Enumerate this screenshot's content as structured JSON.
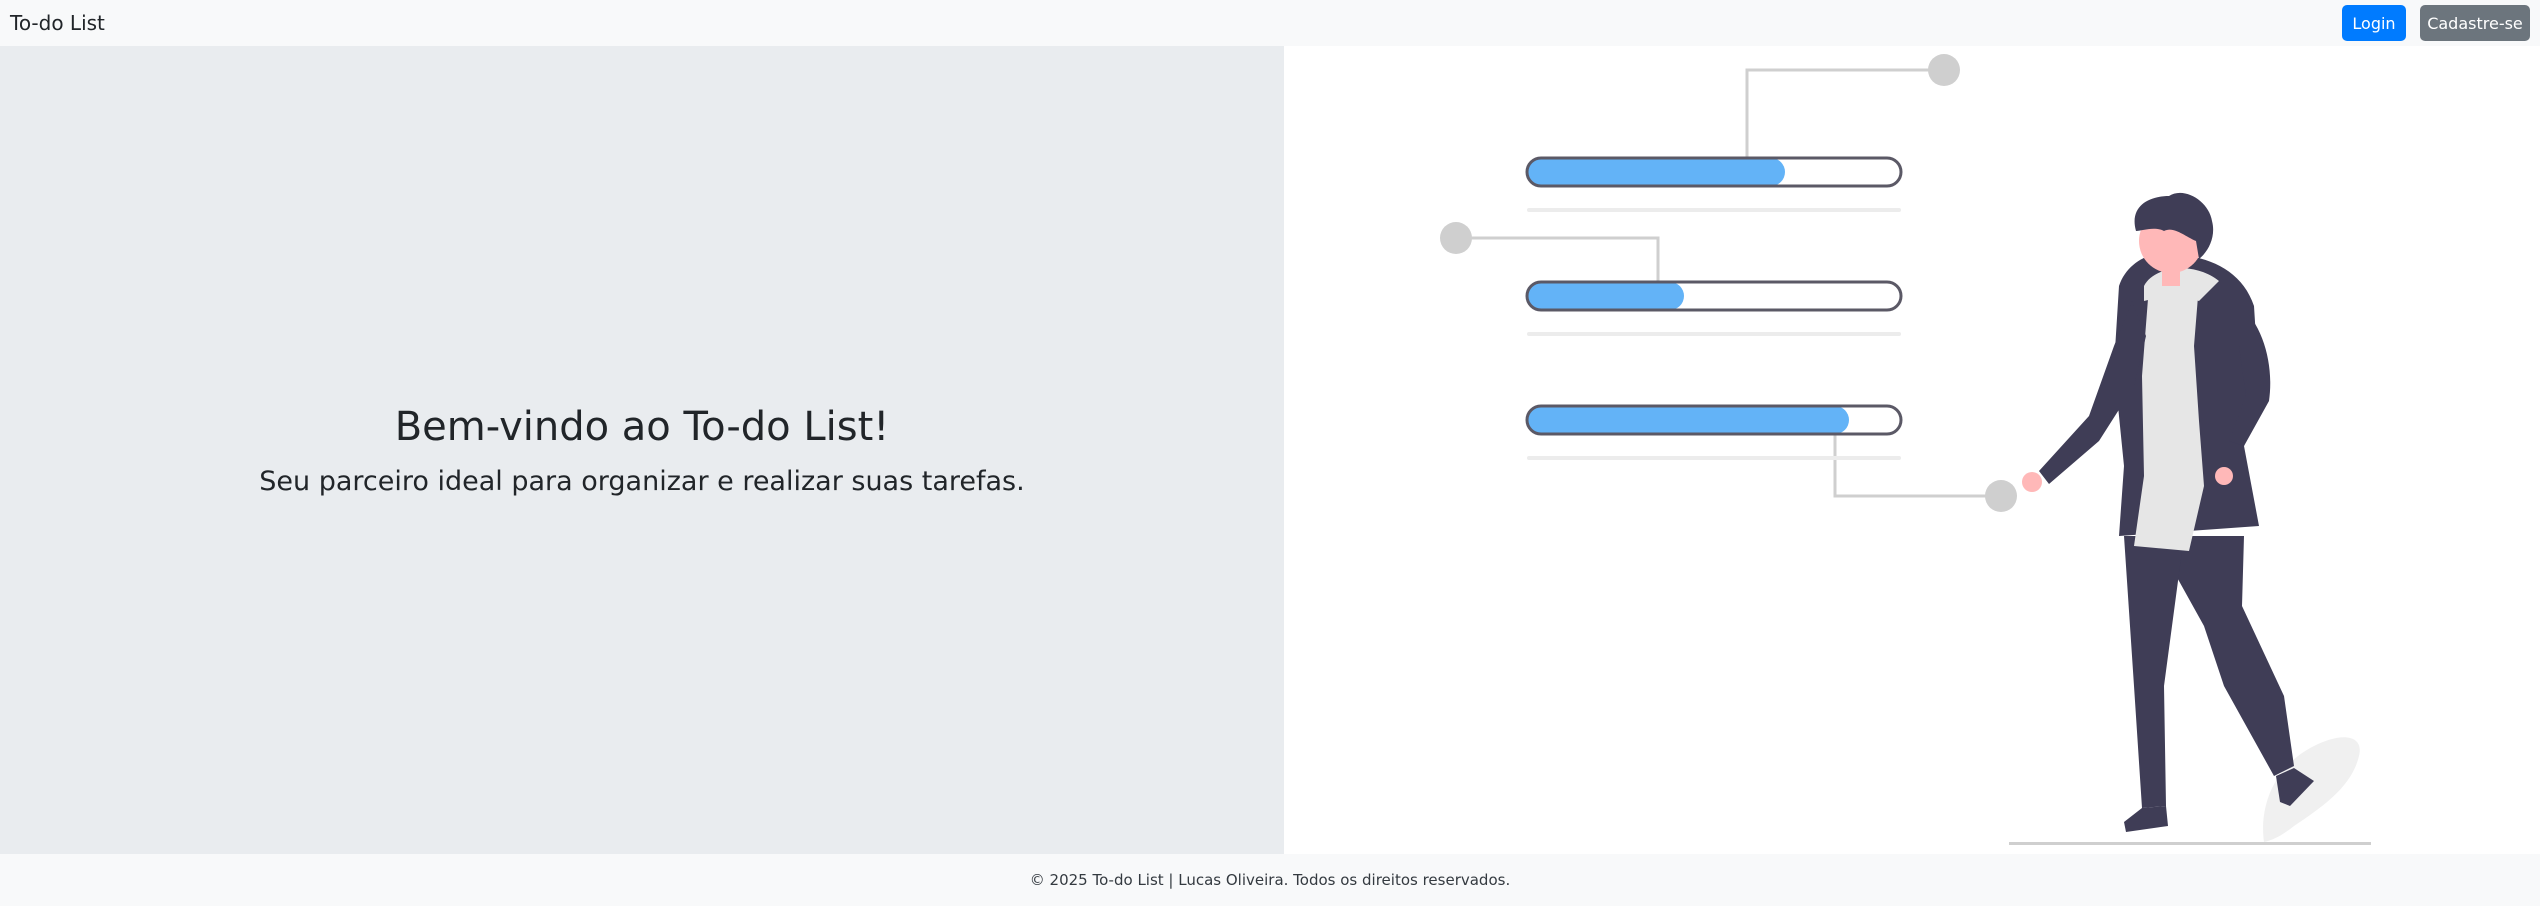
{
  "navbar": {
    "brand": "To-do List",
    "login_label": "Login",
    "signup_label": "Cadastre-se"
  },
  "hero": {
    "title": "Bem-vindo ao To-do List!",
    "subtitle": "Seu parceiro ideal para organizar e realizar suas tarefas."
  },
  "illustration": {
    "progress_bars": [
      {
        "fill_fraction": 0.69
      },
      {
        "fill_fraction": 0.42
      },
      {
        "fill_fraction": 0.86
      }
    ],
    "colors": {
      "bar_fill": "#63b3f7",
      "bar_outline": "#5b5966",
      "connector": "#cfcfcf",
      "person_dark": "#3f3d56",
      "person_light": "#e6e6e6",
      "skin": "#ffb8b8"
    }
  },
  "footer": {
    "text": "© 2025 To-do List | Lucas Oliveira. Todos os direitos reservados."
  }
}
